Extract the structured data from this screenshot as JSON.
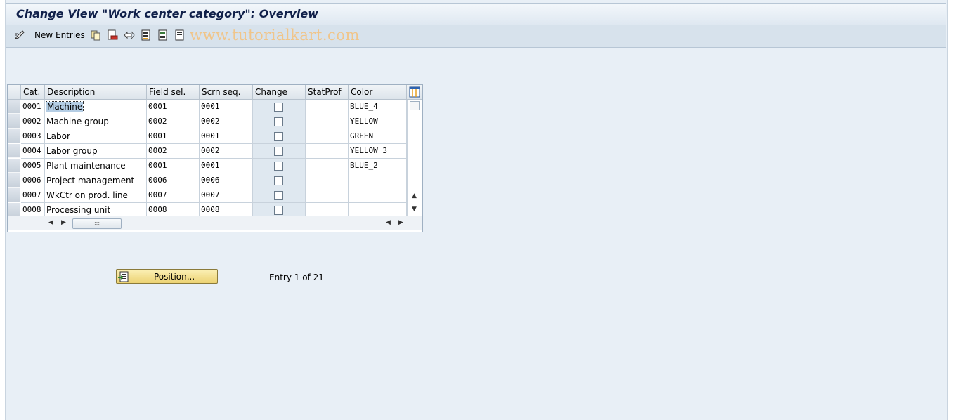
{
  "title": "Change View \"Work center category\": Overview",
  "toolbar": {
    "new_entries_label": "New Entries",
    "watermark": "www.tutorialkart.com"
  },
  "table": {
    "columns": [
      "Cat.",
      "Description",
      "Field sel.",
      "Scrn seq.",
      "Change doc",
      "StatProf",
      "Color"
    ],
    "rows": [
      {
        "cat": "0001",
        "desc": "Machine",
        "field_sel": "0001",
        "scrn_seq": "0001",
        "change_doc": false,
        "stat_prof": "",
        "color": "BLUE_4"
      },
      {
        "cat": "0002",
        "desc": "Machine group",
        "field_sel": "0002",
        "scrn_seq": "0002",
        "change_doc": false,
        "stat_prof": "",
        "color": "YELLOW"
      },
      {
        "cat": "0003",
        "desc": "Labor",
        "field_sel": "0001",
        "scrn_seq": "0001",
        "change_doc": false,
        "stat_prof": "",
        "color": "GREEN"
      },
      {
        "cat": "0004",
        "desc": "Labor group",
        "field_sel": "0002",
        "scrn_seq": "0002",
        "change_doc": false,
        "stat_prof": "",
        "color": "YELLOW_3"
      },
      {
        "cat": "0005",
        "desc": "Plant maintenance",
        "field_sel": "0001",
        "scrn_seq": "0001",
        "change_doc": false,
        "stat_prof": "",
        "color": "BLUE_2"
      },
      {
        "cat": "0006",
        "desc": "Project management",
        "field_sel": "0006",
        "scrn_seq": "0006",
        "change_doc": false,
        "stat_prof": "",
        "color": ""
      },
      {
        "cat": "0007",
        "desc": "WkCtr on prod. line",
        "field_sel": "0007",
        "scrn_seq": "0007",
        "change_doc": false,
        "stat_prof": "",
        "color": ""
      },
      {
        "cat": "0008",
        "desc": "Processing unit",
        "field_sel": "0008",
        "scrn_seq": "0008",
        "change_doc": false,
        "stat_prof": "",
        "color": ""
      }
    ]
  },
  "position_button_label": "Position...",
  "entry_text": "Entry 1 of 21"
}
